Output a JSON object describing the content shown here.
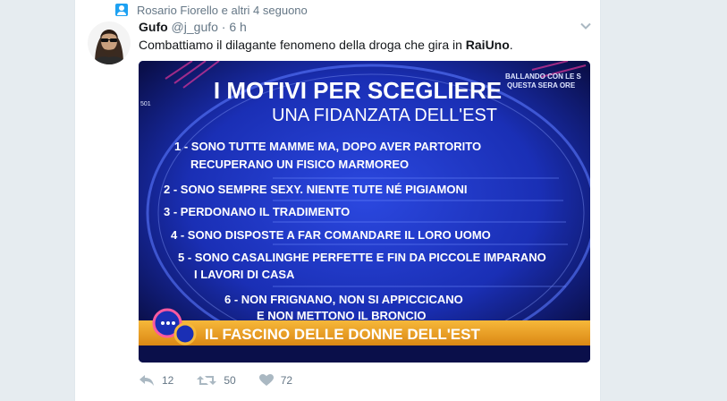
{
  "context": {
    "text": "Rosario Fiorello e altri 4 seguono",
    "icon": "person-icon"
  },
  "tweet": {
    "name": "Gufo",
    "handle": "@j_gufo",
    "separator": " · ",
    "time": "6 h",
    "text_before": "Combattiamo il dilagante fenomeno della droga che gira in ",
    "text_bold": "RaiUno",
    "text_after": "."
  },
  "media": {
    "title": "I MOTIVI PER SCEGLIERE",
    "subtitle": "UNA FIDANZATA DELL'EST",
    "corner_text_1": "BALLANDO CON LE S",
    "corner_text_2": "QUESTA SERA ORE",
    "channel_number": "501",
    "items": [
      {
        "line1": "1 - SONO TUTTE MAMME MA, DOPO AVER PARTORITO",
        "line2": "RECUPERANO UN FISICO MARMOREO"
      },
      {
        "line1": "2 - SONO SEMPRE SEXY. NIENTE TUTE NÉ PIGIAMONI",
        "line2": ""
      },
      {
        "line1": "3 - PERDONANO IL TRADIMENTO",
        "line2": ""
      },
      {
        "line1": "4 - SONO DISPOSTE A FAR COMANDARE IL LORO UOMO",
        "line2": ""
      },
      {
        "line1": "5 - SONO CASALINGHE PERFETTE E FIN DA PICCOLE IMPARANO",
        "line2": "I LAVORI DI CASA"
      },
      {
        "line1": "6 - NON FRIGNANO, NON SI APPICCICANO",
        "line2": "E NON METTONO IL BRONCIO"
      }
    ],
    "banner": "IL FASCINO DELLE DONNE DELL'EST"
  },
  "actions": {
    "reply_count": "12",
    "retweet_count": "50",
    "like_count": "72"
  },
  "colors": {
    "link_blue": "#1da1f2",
    "text_dark": "#14171a",
    "text_gray": "#657786",
    "studio_blue": "#1a2fb5",
    "banner_orange": "#f0a020"
  }
}
